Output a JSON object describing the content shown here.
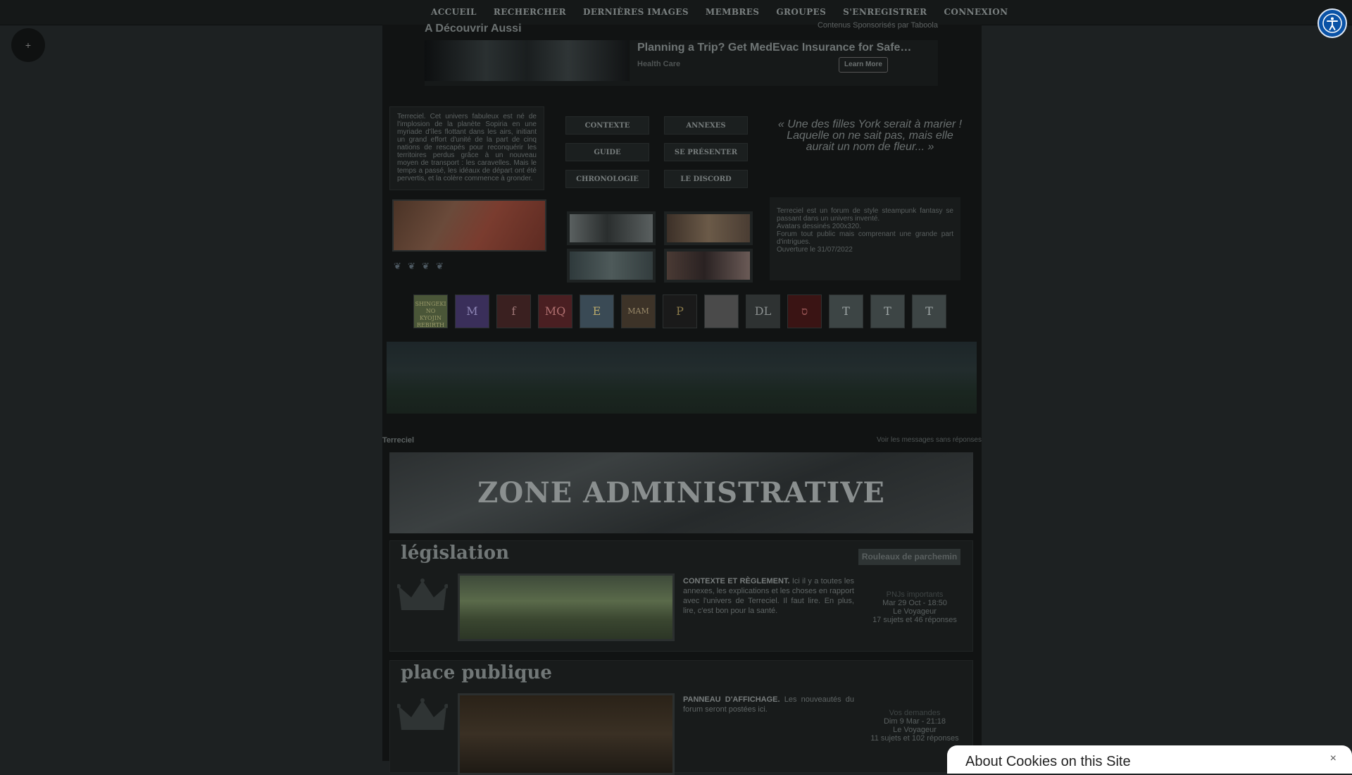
{
  "nav": {
    "items": [
      "ACCUEIL",
      "RECHERCHER",
      "DERNIÈRES IMAGES",
      "MEMBRES",
      "GROUPES",
      "S'ENREGISTRER",
      "CONNEXION"
    ]
  },
  "fab_label": "+",
  "sponsored": {
    "title": "A Découvrir Aussi",
    "by": "Contenus Sponsorisés par Taboola",
    "headline": "Planning a Trip? Get MedEvac Insurance for Safe…",
    "category": "Health Care",
    "cta": "Learn More"
  },
  "intro_text": "Terreciel. Cet univers fabuleux est né de l'implosion de la planète Sopiria en une myriade d'îles flottant dans les airs, initiant un grand effort d'unité de la part de cinq nations de rescapés pour reconquérir les territoires perdus grâce à un nouveau moyen de transport : les caravelles. Mais le temps a passé, les idéaux de départ ont été pervertis, et la colère commence à gronder.",
  "menu": [
    "CONTEXTE",
    "ANNEXES",
    "GUIDE",
    "SE PRÉSENTER",
    "CHRONOLOGIE",
    "LE DISCORD"
  ],
  "quote": "« Une des filles York serait à marier ! Laquelle on ne sait pas, mais elle aurait un nom de fleur... »",
  "info": {
    "lines": [
      "Terreciel est un forum de style steampunk fantasy se passant dans un univers inventé.",
      "Avatars dessinés 200x320.",
      "Forum tout public mais comprenant une grande part d'intrigues.",
      "Ouverture le 31/07/2022"
    ]
  },
  "partners": [
    "SHINGEKI NO KYOJIN REBIRTH",
    "M",
    "f",
    "MQ",
    "E",
    "MAM",
    "P",
    "",
    "DL",
    "ס",
    "T",
    "T",
    "T"
  ],
  "breadcrumb": "Terreciel",
  "unread_link": "Voir les messages sans réponses",
  "zone_title": "ZONE ADMINISTRATIVE",
  "categories": [
    {
      "name": "législation",
      "tag": "Rouleaux de parchemin",
      "forum_title": "CONTEXTE ET RÈGLEMENT.",
      "forum_desc": " Ici il y a toutes les annexes, les explications et les choses en rapport avec l'univers de Terreciel. Il faut lire. En plus, lire, c'est bon pour la santé.",
      "last_topic": "PNJs importants",
      "last_date": "Mar 29 Oct - 18:50",
      "last_author": "Le Voyageur",
      "stats": "17 sujets et 46 réponses"
    },
    {
      "name": "place publique",
      "forum_title": "PANNEAU D'AFFICHAGE.",
      "forum_desc": " Les nouveautés du forum seront postées ici.",
      "last_topic": "Vos demandes",
      "last_date": "Dim 9 Mar - 21:18",
      "last_author": "Le Voyageur",
      "stats": "11 sujets et 102 réponses"
    }
  ],
  "cookie": {
    "title": "About Cookies on this Site",
    "close": "×"
  },
  "colors": {
    "accessibility_button": "#0a52a6",
    "background": "#1d2122",
    "column": "#111313"
  }
}
